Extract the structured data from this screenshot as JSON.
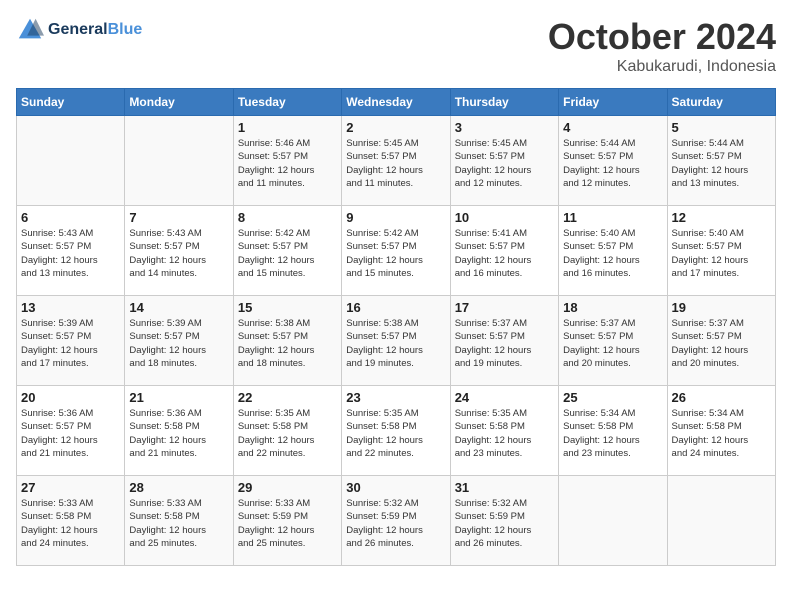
{
  "header": {
    "logo_line1": "General",
    "logo_line2": "Blue",
    "month_title": "October 2024",
    "subtitle": "Kabukarudi, Indonesia"
  },
  "weekdays": [
    "Sunday",
    "Monday",
    "Tuesday",
    "Wednesday",
    "Thursday",
    "Friday",
    "Saturday"
  ],
  "weeks": [
    [
      {
        "day": "",
        "info": ""
      },
      {
        "day": "",
        "info": ""
      },
      {
        "day": "1",
        "info": "Sunrise: 5:46 AM\nSunset: 5:57 PM\nDaylight: 12 hours\nand 11 minutes."
      },
      {
        "day": "2",
        "info": "Sunrise: 5:45 AM\nSunset: 5:57 PM\nDaylight: 12 hours\nand 11 minutes."
      },
      {
        "day": "3",
        "info": "Sunrise: 5:45 AM\nSunset: 5:57 PM\nDaylight: 12 hours\nand 12 minutes."
      },
      {
        "day": "4",
        "info": "Sunrise: 5:44 AM\nSunset: 5:57 PM\nDaylight: 12 hours\nand 12 minutes."
      },
      {
        "day": "5",
        "info": "Sunrise: 5:44 AM\nSunset: 5:57 PM\nDaylight: 12 hours\nand 13 minutes."
      }
    ],
    [
      {
        "day": "6",
        "info": "Sunrise: 5:43 AM\nSunset: 5:57 PM\nDaylight: 12 hours\nand 13 minutes."
      },
      {
        "day": "7",
        "info": "Sunrise: 5:43 AM\nSunset: 5:57 PM\nDaylight: 12 hours\nand 14 minutes."
      },
      {
        "day": "8",
        "info": "Sunrise: 5:42 AM\nSunset: 5:57 PM\nDaylight: 12 hours\nand 15 minutes."
      },
      {
        "day": "9",
        "info": "Sunrise: 5:42 AM\nSunset: 5:57 PM\nDaylight: 12 hours\nand 15 minutes."
      },
      {
        "day": "10",
        "info": "Sunrise: 5:41 AM\nSunset: 5:57 PM\nDaylight: 12 hours\nand 16 minutes."
      },
      {
        "day": "11",
        "info": "Sunrise: 5:40 AM\nSunset: 5:57 PM\nDaylight: 12 hours\nand 16 minutes."
      },
      {
        "day": "12",
        "info": "Sunrise: 5:40 AM\nSunset: 5:57 PM\nDaylight: 12 hours\nand 17 minutes."
      }
    ],
    [
      {
        "day": "13",
        "info": "Sunrise: 5:39 AM\nSunset: 5:57 PM\nDaylight: 12 hours\nand 17 minutes."
      },
      {
        "day": "14",
        "info": "Sunrise: 5:39 AM\nSunset: 5:57 PM\nDaylight: 12 hours\nand 18 minutes."
      },
      {
        "day": "15",
        "info": "Sunrise: 5:38 AM\nSunset: 5:57 PM\nDaylight: 12 hours\nand 18 minutes."
      },
      {
        "day": "16",
        "info": "Sunrise: 5:38 AM\nSunset: 5:57 PM\nDaylight: 12 hours\nand 19 minutes."
      },
      {
        "day": "17",
        "info": "Sunrise: 5:37 AM\nSunset: 5:57 PM\nDaylight: 12 hours\nand 19 minutes."
      },
      {
        "day": "18",
        "info": "Sunrise: 5:37 AM\nSunset: 5:57 PM\nDaylight: 12 hours\nand 20 minutes."
      },
      {
        "day": "19",
        "info": "Sunrise: 5:37 AM\nSunset: 5:57 PM\nDaylight: 12 hours\nand 20 minutes."
      }
    ],
    [
      {
        "day": "20",
        "info": "Sunrise: 5:36 AM\nSunset: 5:57 PM\nDaylight: 12 hours\nand 21 minutes."
      },
      {
        "day": "21",
        "info": "Sunrise: 5:36 AM\nSunset: 5:58 PM\nDaylight: 12 hours\nand 21 minutes."
      },
      {
        "day": "22",
        "info": "Sunrise: 5:35 AM\nSunset: 5:58 PM\nDaylight: 12 hours\nand 22 minutes."
      },
      {
        "day": "23",
        "info": "Sunrise: 5:35 AM\nSunset: 5:58 PM\nDaylight: 12 hours\nand 22 minutes."
      },
      {
        "day": "24",
        "info": "Sunrise: 5:35 AM\nSunset: 5:58 PM\nDaylight: 12 hours\nand 23 minutes."
      },
      {
        "day": "25",
        "info": "Sunrise: 5:34 AM\nSunset: 5:58 PM\nDaylight: 12 hours\nand 23 minutes."
      },
      {
        "day": "26",
        "info": "Sunrise: 5:34 AM\nSunset: 5:58 PM\nDaylight: 12 hours\nand 24 minutes."
      }
    ],
    [
      {
        "day": "27",
        "info": "Sunrise: 5:33 AM\nSunset: 5:58 PM\nDaylight: 12 hours\nand 24 minutes."
      },
      {
        "day": "28",
        "info": "Sunrise: 5:33 AM\nSunset: 5:58 PM\nDaylight: 12 hours\nand 25 minutes."
      },
      {
        "day": "29",
        "info": "Sunrise: 5:33 AM\nSunset: 5:59 PM\nDaylight: 12 hours\nand 25 minutes."
      },
      {
        "day": "30",
        "info": "Sunrise: 5:32 AM\nSunset: 5:59 PM\nDaylight: 12 hours\nand 26 minutes."
      },
      {
        "day": "31",
        "info": "Sunrise: 5:32 AM\nSunset: 5:59 PM\nDaylight: 12 hours\nand 26 minutes."
      },
      {
        "day": "",
        "info": ""
      },
      {
        "day": "",
        "info": ""
      }
    ]
  ]
}
